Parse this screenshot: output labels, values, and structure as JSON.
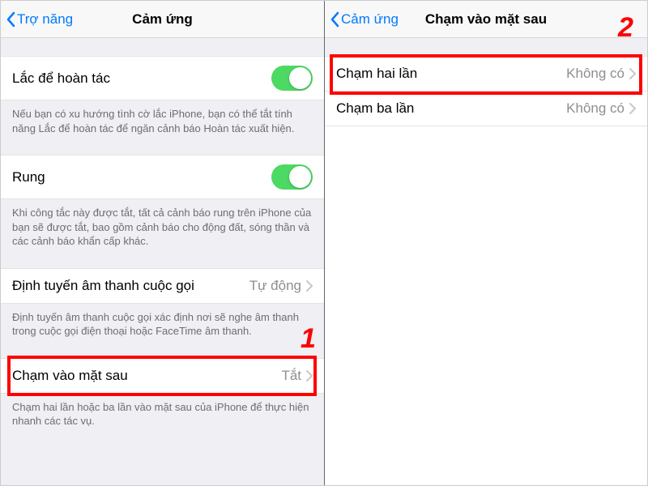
{
  "left": {
    "back_label": "Trợ năng",
    "title": "Cảm ứng",
    "shake": {
      "label": "Lắc để hoàn tác",
      "footer": "Nếu bạn có xu hướng tình cờ lắc iPhone, bạn có thể tắt tính năng Lắc để hoàn tác để ngăn cảnh báo Hoàn tác xuất hiện."
    },
    "vibrate": {
      "label": "Rung",
      "footer": "Khi công tắc này được tắt, tất cả cảnh báo rung trên iPhone của bạn sẽ được tắt, bao gồm cảnh báo cho động đất, sóng thần và các cảnh báo khẩn cấp khác."
    },
    "call_route": {
      "label": "Định tuyến âm thanh cuộc gọi",
      "value": "Tự động",
      "footer": "Định tuyến âm thanh cuộc gọi xác định nơi sẽ nghe âm thanh trong cuộc gọi điện thoại hoặc FaceTime âm thanh."
    },
    "back_tap": {
      "label": "Chạm vào mặt sau",
      "value": "Tắt",
      "footer": "Chạm hai lần hoặc ba lần vào mặt sau của iPhone để thực hiện nhanh các tác vụ."
    }
  },
  "right": {
    "back_label": "Cảm ứng",
    "title": "Chạm vào mặt sau",
    "double": {
      "label": "Chạm hai lần",
      "value": "Không có"
    },
    "triple": {
      "label": "Chạm ba lần",
      "value": "Không có"
    }
  },
  "annotations": {
    "marker1": "1",
    "marker2": "2"
  }
}
